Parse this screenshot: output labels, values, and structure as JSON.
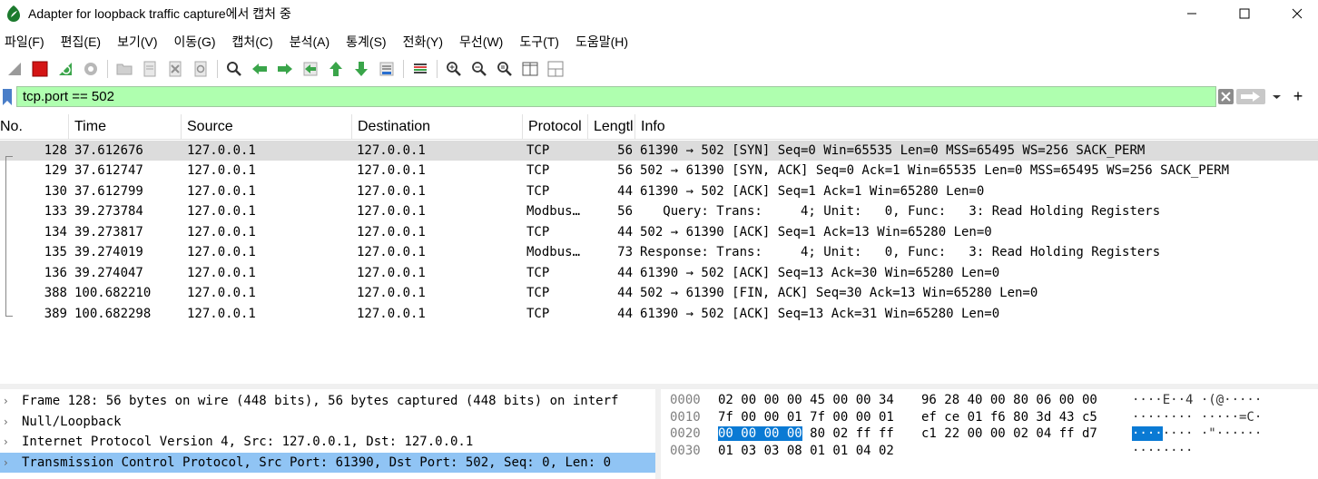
{
  "window": {
    "title": "Adapter for loopback traffic capture에서 캡처 중"
  },
  "menu": [
    "파일(F)",
    "편집(E)",
    "보기(V)",
    "이동(G)",
    "캡처(C)",
    "분석(A)",
    "통계(S)",
    "전화(Y)",
    "무선(W)",
    "도구(T)",
    "도움말(H)"
  ],
  "toolbar": {
    "icons": [
      "shark-fin-start-icon",
      "stop-icon",
      "restart-icon",
      "capture-options-icon",
      "open-file-icon",
      "save-file-icon",
      "close-file-icon",
      "reload-icon",
      "find-icon",
      "back-arrow-icon",
      "forward-arrow-icon",
      "go-to-packet-icon",
      "first-packet-icon",
      "last-packet-icon",
      "autoscroll-icon",
      "colorize-icon",
      "zoom-in-icon",
      "zoom-out-icon",
      "normal-size-icon",
      "resize-columns-icon",
      "layout-icon"
    ]
  },
  "filter": {
    "value": "tcp.port == 502",
    "bg_color": "#afffaf"
  },
  "packet_list": {
    "columns": [
      "No.",
      "Time",
      "Source",
      "Destination",
      "Protocol",
      "Length",
      "Info"
    ],
    "column_display": [
      "No.",
      "Time",
      "Source",
      "Destination",
      "Protocol",
      "Lengtl",
      "Info"
    ],
    "rows": [
      {
        "no": "128",
        "time": "37.612676",
        "src": "127.0.0.1",
        "dst": "127.0.0.1",
        "proto": "TCP",
        "len": "56",
        "info": "61390 → 502 [SYN] Seq=0 Win=65535 Len=0 MSS=65495 WS=256 SACK_PERM",
        "selected": true
      },
      {
        "no": "129",
        "time": "37.612747",
        "src": "127.0.0.1",
        "dst": "127.0.0.1",
        "proto": "TCP",
        "len": "56",
        "info": "502 → 61390 [SYN, ACK] Seq=0 Ack=1 Win=65535 Len=0 MSS=65495 WS=256 SACK_PERM",
        "selected": false
      },
      {
        "no": "130",
        "time": "37.612799",
        "src": "127.0.0.1",
        "dst": "127.0.0.1",
        "proto": "TCP",
        "len": "44",
        "info": "61390 → 502 [ACK] Seq=1 Ack=1 Win=65280 Len=0",
        "selected": false
      },
      {
        "no": "133",
        "time": "39.273784",
        "src": "127.0.0.1",
        "dst": "127.0.0.1",
        "proto": "Modbus…",
        "len": "56",
        "info": "   Query: Trans:     4; Unit:   0, Func:   3: Read Holding Registers",
        "selected": false
      },
      {
        "no": "134",
        "time": "39.273817",
        "src": "127.0.0.1",
        "dst": "127.0.0.1",
        "proto": "TCP",
        "len": "44",
        "info": "502 → 61390 [ACK] Seq=1 Ack=13 Win=65280 Len=0",
        "selected": false
      },
      {
        "no": "135",
        "time": "39.274019",
        "src": "127.0.0.1",
        "dst": "127.0.0.1",
        "proto": "Modbus…",
        "len": "73",
        "info": "Response: Trans:     4; Unit:   0, Func:   3: Read Holding Registers",
        "selected": false
      },
      {
        "no": "136",
        "time": "39.274047",
        "src": "127.0.0.1",
        "dst": "127.0.0.1",
        "proto": "TCP",
        "len": "44",
        "info": "61390 → 502 [ACK] Seq=13 Ack=30 Win=65280 Len=0",
        "selected": false
      },
      {
        "no": "388",
        "time": "100.682210",
        "src": "127.0.0.1",
        "dst": "127.0.0.1",
        "proto": "TCP",
        "len": "44",
        "info": "502 → 61390 [FIN, ACK] Seq=30 Ack=13 Win=65280 Len=0",
        "selected": false
      },
      {
        "no": "389",
        "time": "100.682298",
        "src": "127.0.0.1",
        "dst": "127.0.0.1",
        "proto": "TCP",
        "len": "44",
        "info": "61390 → 502 [ACK] Seq=13 Ack=31 Win=65280 Len=0",
        "selected": false
      }
    ],
    "selected_color": "#dcdcdc"
  },
  "detail_tree": [
    {
      "text": "Frame 128: 56 bytes on wire (448 bits), 56 bytes captured (448 bits) on interf",
      "selected": false
    },
    {
      "text": "Null/Loopback",
      "selected": false
    },
    {
      "text": "Internet Protocol Version 4, Src: 127.0.0.1, Dst: 127.0.0.1",
      "selected": false
    },
    {
      "text": "Transmission Control Protocol, Src Port: 61390, Dst Port: 502, Seq: 0, Len: 0",
      "selected": true
    }
  ],
  "bytes": [
    {
      "offset": "0000",
      "hex1": "02 00 00 00 45 00 00 34",
      "hex2": "96 28 40 00 80 06 00 00",
      "ascii_pre": "",
      "ascii_hl": "",
      "ascii_post": "····E··4 ·(@·····"
    },
    {
      "offset": "0010",
      "hex1": "7f 00 00 01 7f 00 00 01",
      "hex2": "ef ce 01 f6 80 3d 43 c5",
      "ascii_pre": "",
      "ascii_hl": "",
      "ascii_post": "········ ·····=C·"
    },
    {
      "offset": "0020",
      "hex1_hl": "00 00 00 00",
      "hex1_rest": " 80 02 ff ff",
      "hex2": "c1 22 00 00 02 04 ff d7",
      "ascii_hl": "····",
      "ascii_post": "···· ·\"······"
    },
    {
      "offset": "0030",
      "hex1": "01 03 03 08 01 01 04 02",
      "hex2": "",
      "ascii_pre": "",
      "ascii_hl": "",
      "ascii_post": "········"
    }
  ],
  "colors": {
    "highlight": "#0a7ad4",
    "detail_selected": "#90c4f4"
  }
}
